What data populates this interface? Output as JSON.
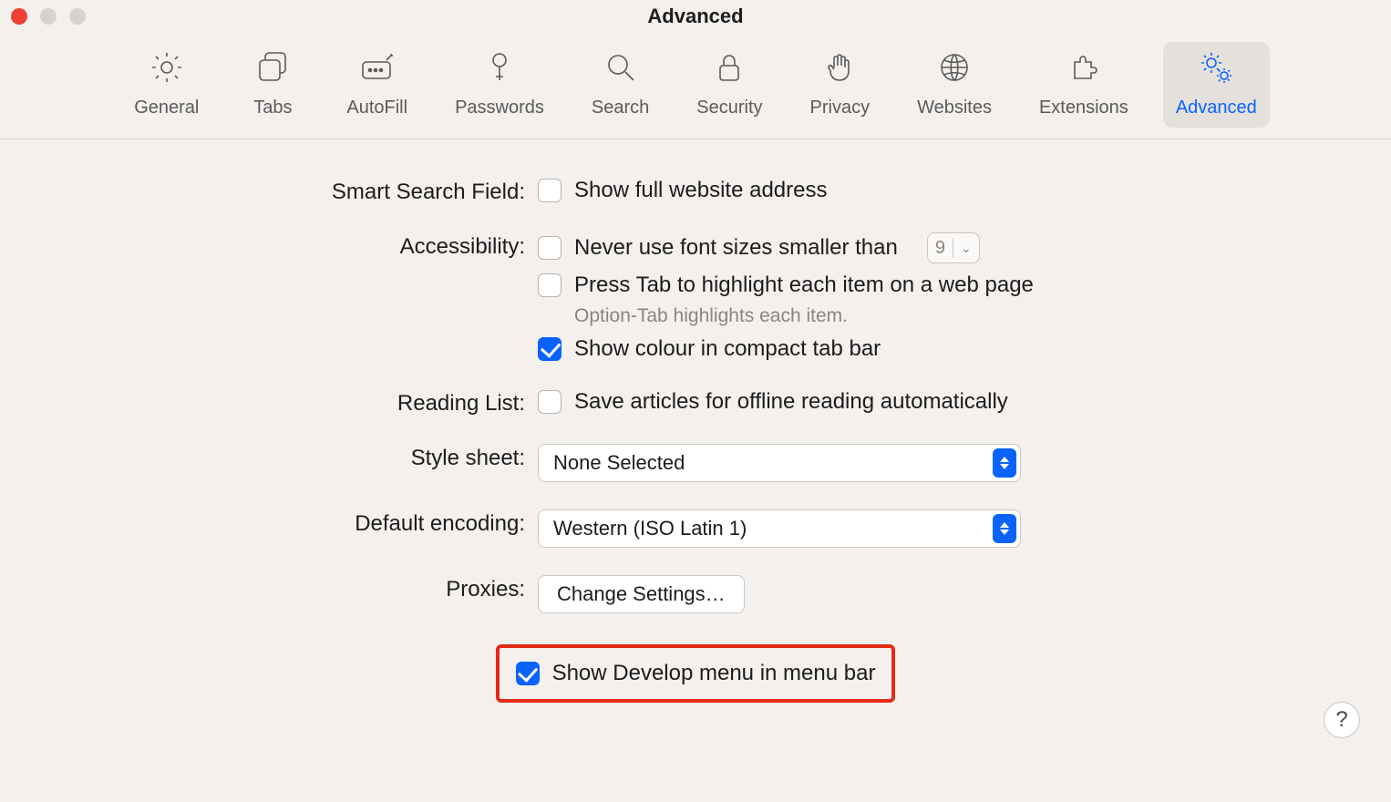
{
  "window": {
    "title": "Advanced"
  },
  "tabs": {
    "general": "General",
    "tabs": "Tabs",
    "autofill": "AutoFill",
    "passwords": "Passwords",
    "search": "Search",
    "security": "Security",
    "privacy": "Privacy",
    "websites": "Websites",
    "extensions": "Extensions",
    "advanced": "Advanced",
    "active": "advanced"
  },
  "sections": {
    "smart_search": {
      "label": "Smart Search Field:",
      "show_full_address": {
        "text": "Show full website address",
        "checked": false
      }
    },
    "accessibility": {
      "label": "Accessibility:",
      "never_smaller": {
        "text": "Never use font sizes smaller than",
        "checked": false,
        "value": "9"
      },
      "press_tab": {
        "text": "Press Tab to highlight each item on a web page",
        "checked": false
      },
      "press_tab_hint": "Option-Tab highlights each item.",
      "show_colour": {
        "text": "Show colour in compact tab bar",
        "checked": true
      }
    },
    "reading_list": {
      "label": "Reading List:",
      "save_offline": {
        "text": "Save articles for offline reading automatically",
        "checked": false
      }
    },
    "style_sheet": {
      "label": "Style sheet:",
      "value": "None Selected"
    },
    "default_encoding": {
      "label": "Default encoding:",
      "value": "Western (ISO Latin 1)"
    },
    "proxies": {
      "label": "Proxies:",
      "button": "Change Settings…"
    },
    "develop": {
      "show_develop": {
        "text": "Show Develop menu in menu bar",
        "checked": true
      }
    }
  },
  "help": "?"
}
